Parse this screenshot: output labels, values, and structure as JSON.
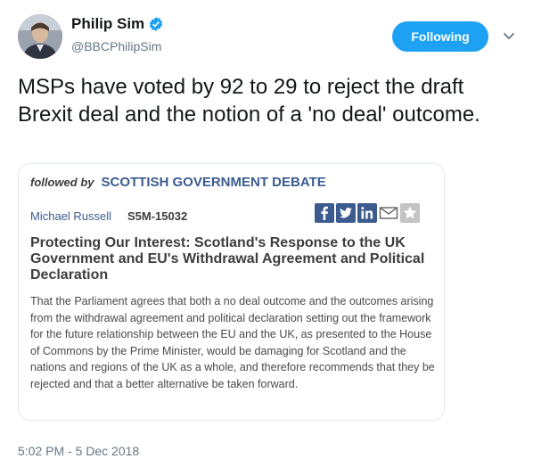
{
  "user": {
    "display_name": "Philip Sim",
    "handle": "@BBCPhilipSim",
    "verified_icon": "verified-badge-icon"
  },
  "follow_button": {
    "label": "Following"
  },
  "tweet": {
    "text": "MSPs have voted by 92 to 29 to reject the draft Brexit deal and the notion of a 'no deal' outcome.",
    "timestamp": "5:02 PM - 5 Dec 2018"
  },
  "card": {
    "followed_by_label": "followed by",
    "debate_label": "SCOTTISH GOVERNMENT DEBATE",
    "member": "Michael Russell",
    "motion_ref": "S5M-15032",
    "share_icons": [
      "facebook-icon",
      "twitter-icon",
      "linkedin-icon",
      "email-icon",
      "star-icon"
    ],
    "title": "Protecting Our Interest: Scotland's Response to the UK Government and EU's Withdrawal Agreement and Political Declaration",
    "body": "That the Parliament agrees that both a no deal outcome and the outcomes arising from the withdrawal agreement and political declaration setting out the framework for the future relationship between the EU and the UK, as presented to the House of Commons by the Prime Minister, would be damaging for Scotland and the nations and regions of the UK as a whole, and therefore recommends that they be rejected and that a better alternative be taken forward."
  },
  "colors": {
    "accent": "#1da1f2",
    "link": "#3b5b8e",
    "muted": "#657786",
    "share_buttons": "#3b5b8e"
  }
}
